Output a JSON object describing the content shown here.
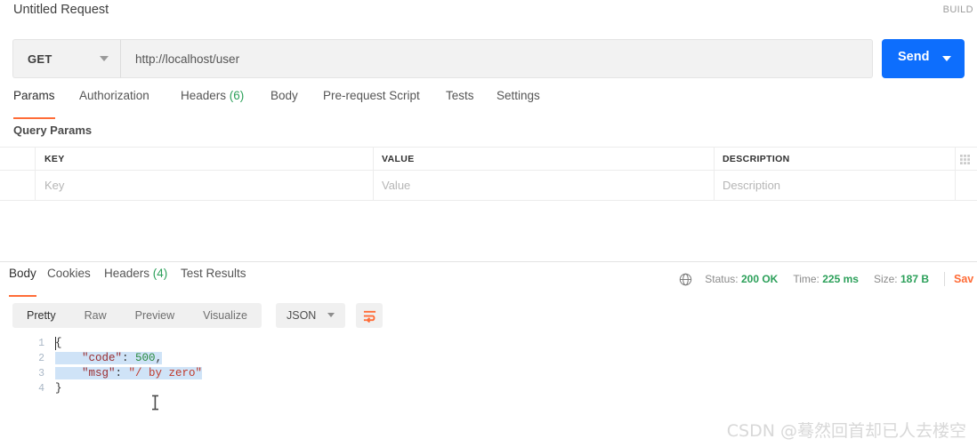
{
  "header": {
    "request_title": "Untitled Request",
    "build_label": "BUILD"
  },
  "url_bar": {
    "method": "GET",
    "url": "http://localhost/user",
    "send_label": "Send"
  },
  "request_tabs": [
    {
      "label": "Params",
      "count": "",
      "active": true
    },
    {
      "label": "Authorization",
      "count": "",
      "active": false
    },
    {
      "label": "Headers",
      "count": "(6)",
      "active": false
    },
    {
      "label": "Body",
      "count": "",
      "active": false
    },
    {
      "label": "Pre-request Script",
      "count": "",
      "active": false
    },
    {
      "label": "Tests",
      "count": "",
      "active": false
    },
    {
      "label": "Settings",
      "count": "",
      "active": false
    }
  ],
  "query_params": {
    "section_label": "Query Params",
    "columns": [
      "KEY",
      "VALUE",
      "DESCRIPTION"
    ],
    "rows": [
      {
        "key": "Key",
        "value": "Value",
        "description": "Description"
      }
    ]
  },
  "response_tabs": [
    {
      "label": "Body",
      "count": "",
      "active": true
    },
    {
      "label": "Cookies",
      "count": "",
      "active": false
    },
    {
      "label": "Headers",
      "count": "(4)",
      "active": false
    },
    {
      "label": "Test Results",
      "count": "",
      "active": false
    }
  ],
  "response_meta": {
    "status_label": "Status:",
    "status_value": "200 OK",
    "time_label": "Time:",
    "time_value": "225 ms",
    "size_label": "Size:",
    "size_value": "187 B",
    "save_label": "Sav"
  },
  "format_bar": {
    "segments": [
      {
        "label": "Pretty",
        "active": true
      },
      {
        "label": "Raw",
        "active": false
      },
      {
        "label": "Preview",
        "active": false
      },
      {
        "label": "Visualize",
        "active": false
      }
    ],
    "language": "JSON"
  },
  "response_body": {
    "line_numbers": [
      "1",
      "2",
      "3",
      "4"
    ],
    "lines": [
      {
        "tokens": [
          {
            "text": "{",
            "type": "punc"
          }
        ]
      },
      {
        "tokens": [
          {
            "text": "    ",
            "type": "punc"
          },
          {
            "text": "\"code\"",
            "type": "key"
          },
          {
            "text": ": ",
            "type": "punc"
          },
          {
            "text": "500",
            "type": "num"
          },
          {
            "text": ",",
            "type": "punc"
          }
        ]
      },
      {
        "tokens": [
          {
            "text": "    ",
            "type": "punc"
          },
          {
            "text": "\"msg\"",
            "type": "key"
          },
          {
            "text": ": ",
            "type": "punc"
          },
          {
            "text": "\"/ by zero\"",
            "type": "str"
          }
        ]
      },
      {
        "tokens": [
          {
            "text": "}",
            "type": "punc"
          }
        ]
      }
    ],
    "raw_text": "{\n    \"code\": 500,\n    \"msg\": \"/ by zero\"\n}"
  },
  "watermark": {
    "text": "CSDN @蓦然回首却已人去楼空"
  },
  "colors": {
    "accent_orange": "#ff6c37",
    "send_blue": "#0d6efd",
    "status_green": "#2ca05a",
    "selection_blue": "#cfe3f7"
  }
}
